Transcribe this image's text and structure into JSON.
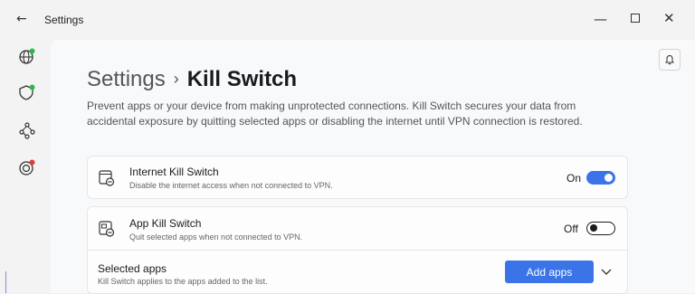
{
  "window": {
    "title": "Settings",
    "back_icon": "arrow-left-icon",
    "controls": [
      "minimize",
      "maximize",
      "close"
    ]
  },
  "sidebar": {
    "items": [
      {
        "icon": "globe-icon",
        "status_color": "#2db84d"
      },
      {
        "icon": "shield-icon",
        "status_color": "#2db84d"
      },
      {
        "icon": "meshnet-icon"
      },
      {
        "icon": "target-icon",
        "status_color": "#e0393e"
      }
    ]
  },
  "header": {
    "notification_icon": "bell-icon"
  },
  "breadcrumb": {
    "parent": "Settings",
    "separator": "›",
    "current": "Kill Switch"
  },
  "description": "Prevent apps or your device from making unprotected connections. Kill Switch secures your data from accidental exposure by quitting selected apps or disabling the internet until VPN connection is restored.",
  "internet_kill_switch": {
    "title": "Internet Kill Switch",
    "subtitle": "Disable the internet access when not connected to VPN.",
    "state_label": "On",
    "enabled": true
  },
  "app_kill_switch": {
    "title": "App Kill Switch",
    "subtitle": "Quit selected apps when not connected to VPN.",
    "state_label": "Off",
    "enabled": false
  },
  "selected_apps": {
    "title": "Selected apps",
    "subtitle": "Kill Switch applies to the apps added to the list.",
    "add_button": "Add apps"
  },
  "colors": {
    "accent": "#3b74e8",
    "status_green": "#2db84d",
    "status_red": "#e0393e"
  }
}
